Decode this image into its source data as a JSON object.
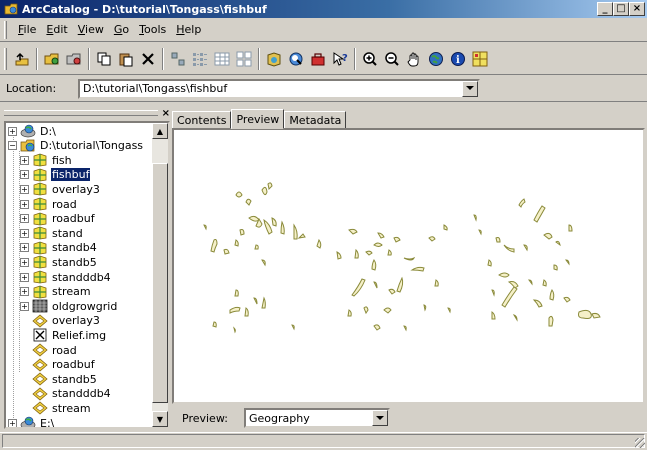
{
  "window": {
    "title": "ArcCatalog - D:\\tutorial\\Tongass\\fishbuf",
    "controls": [
      "_",
      "□",
      "×"
    ]
  },
  "menu": [
    "File",
    "Edit",
    "View",
    "Go",
    "Tools",
    "Help"
  ],
  "toolbar": {
    "buttons": [
      "up-one-level-icon",
      "connect-folder-icon",
      "disconnect-folder-icon",
      "copy-icon",
      "paste-icon",
      "delete-icon",
      "large-icons-icon",
      "list-icon",
      "details-icon",
      "thumbnails-icon",
      "launch-arcmap-icon",
      "search-icon",
      "arctoolbox-icon",
      "whats-this-icon",
      "zoom-in-icon",
      "zoom-out-icon",
      "pan-icon",
      "full-extent-icon",
      "identify-icon",
      "create-thumbnail-icon"
    ]
  },
  "location": {
    "label": "Location:",
    "value": "D:\\tutorial\\Tongass\\fishbuf"
  },
  "tree": {
    "items": [
      {
        "label": "D:\\",
        "icon": "drive-icon",
        "expander": "+",
        "level": 0
      },
      {
        "label": "D:\\tutorial\\Tongass",
        "icon": "folder-connection-icon",
        "expander": "−",
        "level": 0
      },
      {
        "label": "fish",
        "icon": "coverage-icon",
        "expander": "+",
        "level": 1
      },
      {
        "label": "fishbuf",
        "icon": "coverage-icon",
        "expander": "+",
        "level": 1,
        "selected": true
      },
      {
        "label": "overlay3",
        "icon": "coverage-icon",
        "expander": "+",
        "level": 1
      },
      {
        "label": "road",
        "icon": "coverage-icon",
        "expander": "+",
        "level": 1
      },
      {
        "label": "roadbuf",
        "icon": "coverage-icon",
        "expander": "+",
        "level": 1
      },
      {
        "label": "stand",
        "icon": "coverage-icon",
        "expander": "+",
        "level": 1
      },
      {
        "label": "standb4",
        "icon": "coverage-icon",
        "expander": "+",
        "level": 1
      },
      {
        "label": "standb5",
        "icon": "coverage-icon",
        "expander": "+",
        "level": 1
      },
      {
        "label": "standddb4",
        "icon": "coverage-icon",
        "expander": "+",
        "level": 1
      },
      {
        "label": "stream",
        "icon": "coverage-icon",
        "expander": "+",
        "level": 1
      },
      {
        "label": "oldgrowgrid",
        "icon": "grid-icon",
        "expander": "+",
        "level": 1
      },
      {
        "label": "overlay3",
        "icon": "layer-icon",
        "expander": "",
        "level": 1
      },
      {
        "label": "Relief.img",
        "icon": "raster-icon",
        "expander": "",
        "level": 1
      },
      {
        "label": "road",
        "icon": "layer-icon",
        "expander": "",
        "level": 1
      },
      {
        "label": "roadbuf",
        "icon": "layer-icon",
        "expander": "",
        "level": 1
      },
      {
        "label": "standb5",
        "icon": "layer-icon",
        "expander": "",
        "level": 1
      },
      {
        "label": "standddb4",
        "icon": "layer-icon",
        "expander": "",
        "level": 1
      },
      {
        "label": "stream",
        "icon": "layer-icon",
        "expander": "",
        "level": 1
      },
      {
        "label": "E:\\",
        "icon": "drive-icon",
        "expander": "+",
        "level": 0
      }
    ]
  },
  "tabs": [
    "Contents",
    "Preview",
    "Metadata"
  ],
  "active_tab": "Preview",
  "preview": {
    "label": "Preview:",
    "mode": "Geography",
    "polygon_fill": "#f5f0c8",
    "polygon_stroke": "#8a8a3a"
  },
  "colors": {
    "selection": "#0a246a",
    "title_gradient_start": "#0a246a",
    "chrome": "#d4d0c8"
  }
}
